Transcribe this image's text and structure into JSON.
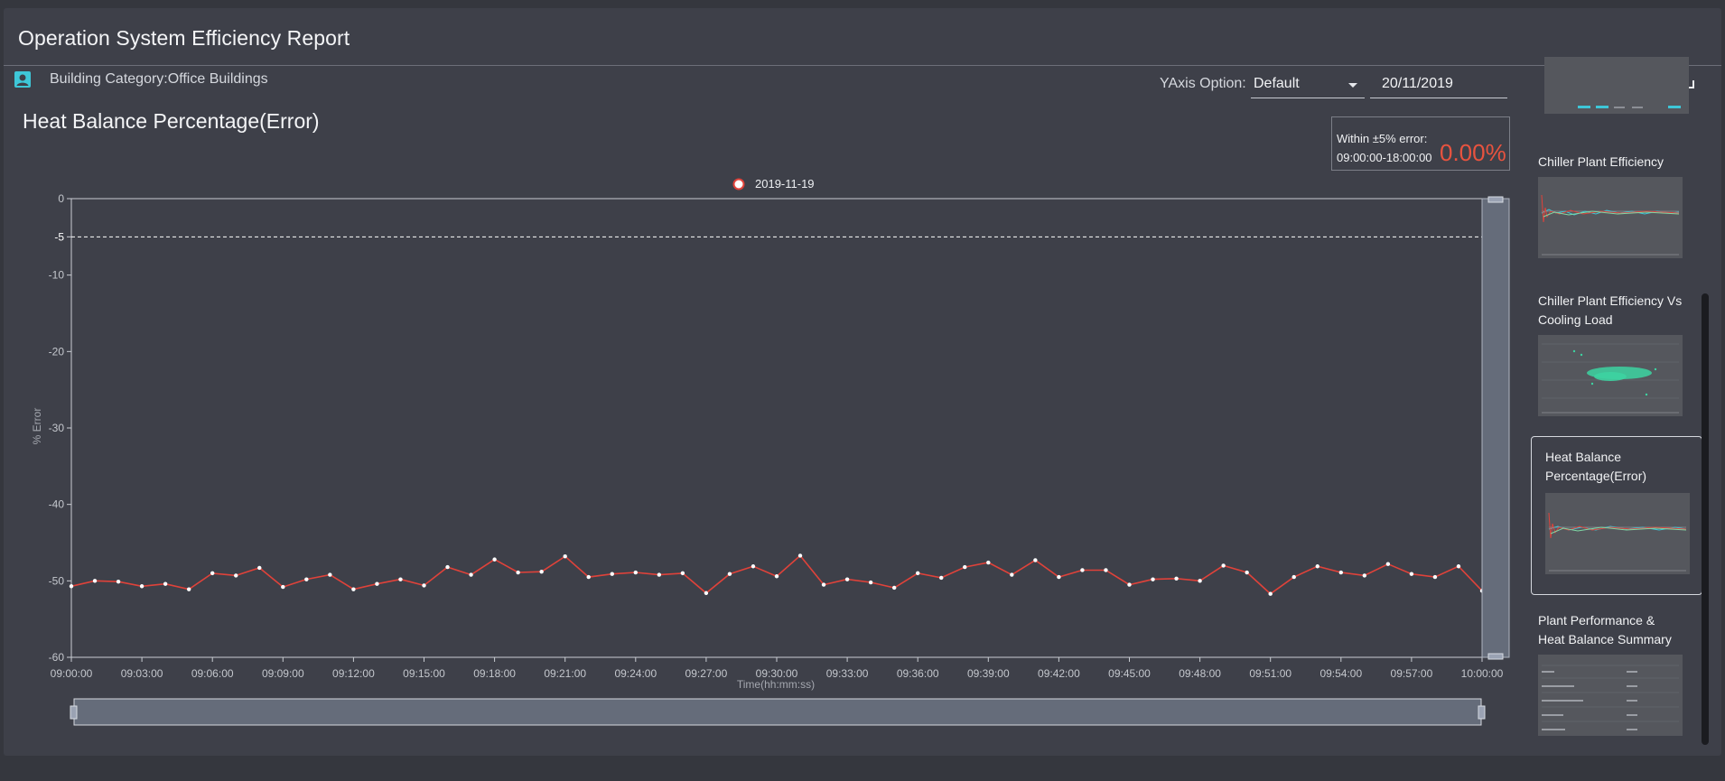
{
  "header": {
    "title": "Operation System Efficiency Report"
  },
  "category": {
    "icon": "user-badge-icon",
    "label": "Building Category:Office Buildings"
  },
  "yaxis_option": {
    "label": "YAxis Option:",
    "value": "Default"
  },
  "date": {
    "value": "20/11/2019"
  },
  "chart_title": "Heat Balance Percentage(Error)",
  "stats": {
    "line1": "Within ±5% error:",
    "line2": "09:00:00-18:00:00",
    "value": "0.00%"
  },
  "toolbar": {
    "download_icon": "download-icon",
    "return_icon": "return-icon"
  },
  "thumbnails": [
    {
      "title_lines": [
        "Chiller Plant Efficiency"
      ]
    },
    {
      "title_lines": [
        "Chiller Plant Efficiency Vs",
        "Cooling Load"
      ]
    },
    {
      "title_lines": [
        "Heat Balance",
        "Percentage(Error)"
      ],
      "selected": true
    },
    {
      "title_lines": [
        "Plant Performance &",
        "Heat Balance Summary"
      ]
    }
  ],
  "colors": {
    "accent": "#3ec7d8",
    "series": "#e0423a",
    "stat": "#e8533f"
  },
  "chart_data": {
    "type": "line",
    "title": "Heat Balance Percentage(Error)",
    "xlabel": "Time(hh:mm:ss)",
    "ylabel": "% Error",
    "ylim": [
      -60,
      0
    ],
    "yticks": [
      0,
      -5,
      -10,
      -20,
      -30,
      -40,
      -50,
      -60
    ],
    "reference_line": -5,
    "x_tick_labels": [
      "09:00:00",
      "09:03:00",
      "09:06:00",
      "09:09:00",
      "09:12:00",
      "09:15:00",
      "09:18:00",
      "09:21:00",
      "09:24:00",
      "09:27:00",
      "09:30:00",
      "09:33:00",
      "09:36:00",
      "09:39:00",
      "09:42:00",
      "09:45:00",
      "09:48:00",
      "09:51:00",
      "09:54:00",
      "09:57:00",
      "10:00:00"
    ],
    "legend": "top-center",
    "series": [
      {
        "name": "2019-11-19",
        "x_minutes": [
          0,
          1,
          2,
          3,
          4,
          5,
          6,
          7,
          8,
          9,
          10,
          11,
          12,
          13,
          14,
          15,
          16,
          17,
          18,
          19,
          20,
          21,
          22,
          23,
          24,
          25,
          26,
          27,
          28,
          29,
          30,
          31,
          32,
          33,
          34,
          35,
          36,
          37,
          38,
          39,
          40,
          41,
          42,
          43,
          44,
          45,
          46,
          47,
          48,
          49,
          50,
          51,
          52,
          53,
          54,
          55,
          56,
          57,
          58,
          59,
          60
        ],
        "values": [
          -50.7,
          -50.0,
          -50.1,
          -50.7,
          -50.4,
          -51.1,
          -49.0,
          -49.3,
          -48.3,
          -50.8,
          -49.8,
          -49.2,
          -51.1,
          -50.4,
          -49.8,
          -50.6,
          -48.2,
          -49.2,
          -47.2,
          -48.9,
          -48.8,
          -46.8,
          -49.5,
          -49.1,
          -48.9,
          -49.2,
          -49.0,
          -51.6,
          -49.1,
          -48.1,
          -49.4,
          -46.7,
          -50.5,
          -49.8,
          -50.2,
          -50.9,
          -49.0,
          -49.6,
          -48.2,
          -47.6,
          -49.2,
          -47.3,
          -49.5,
          -48.6,
          -48.6,
          -50.5,
          -49.8,
          -49.7,
          -50.0,
          -48.0,
          -48.9,
          -51.7,
          -49.5,
          -48.1,
          -48.9,
          -49.3,
          -47.8,
          -49.1,
          -49.5,
          -48.1,
          -51.3
        ]
      }
    ]
  }
}
